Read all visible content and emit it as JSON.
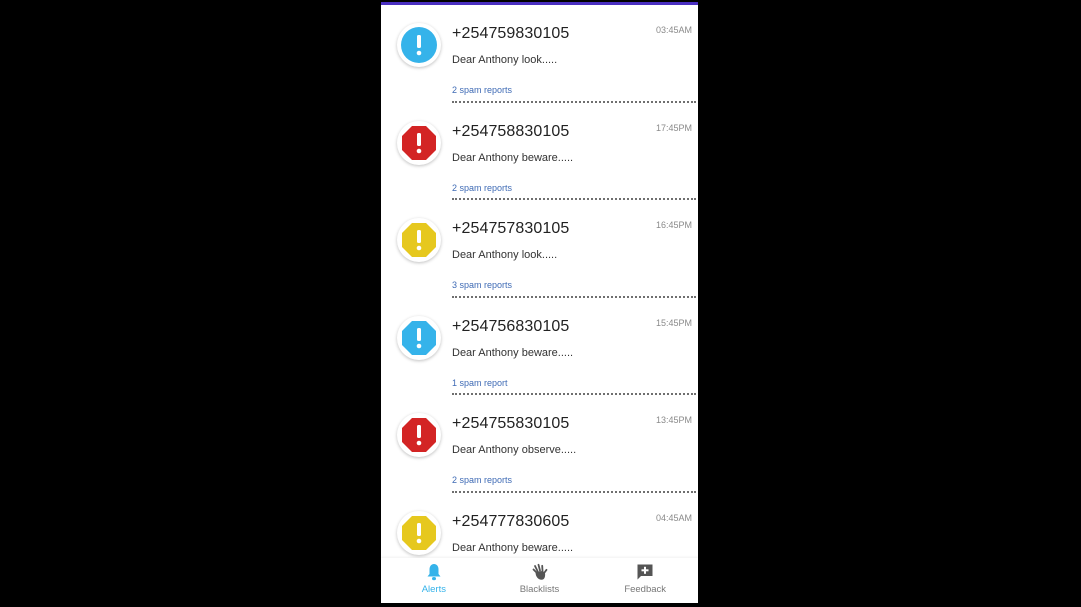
{
  "colors": {
    "accent": "#35b3ea",
    "status_blue": "#35b3ea",
    "status_red": "#d32424",
    "status_yellow": "#e6c81e",
    "top_bar": "#4a2fc0",
    "link": "#3f6bb5"
  },
  "alerts": [
    {
      "number": "+254759830105",
      "time": "03:45AM",
      "message": "Dear Anthony look.....",
      "reports": "2 spam reports",
      "level_color": "blue",
      "icon": "alert-octagon-icon"
    },
    {
      "number": "+254758830105",
      "time": "17:45PM",
      "message": "Dear Anthony beware.....",
      "reports": "2 spam reports",
      "level_color": "red",
      "icon": "alert-octagon-icon"
    },
    {
      "number": "+254757830105",
      "time": "16:45PM",
      "message": "Dear Anthony look.....",
      "reports": "3 spam reports",
      "level_color": "yellow",
      "icon": "alert-octagon-icon"
    },
    {
      "number": "+254756830105",
      "time": "15:45PM",
      "message": "Dear Anthony beware.....",
      "reports": "1 spam report",
      "level_color": "blue",
      "icon": "alert-octagon-icon"
    },
    {
      "number": "+254755830105",
      "time": "13:45PM",
      "message": "Dear Anthony observe.....",
      "reports": "2 spam reports",
      "level_color": "red",
      "icon": "alert-octagon-icon"
    },
    {
      "number": "+254777830605",
      "time": "04:45AM",
      "message": "Dear Anthony beware.....",
      "reports": "",
      "level_color": "yellow",
      "icon": "alert-octagon-icon"
    }
  ],
  "bottom_nav": [
    {
      "label": "Alerts",
      "icon": "bell-icon",
      "active": true
    },
    {
      "label": "Blacklists",
      "icon": "hand-stop-icon",
      "active": false
    },
    {
      "label": "Feedback",
      "icon": "feedback-plus-icon",
      "active": false
    }
  ]
}
